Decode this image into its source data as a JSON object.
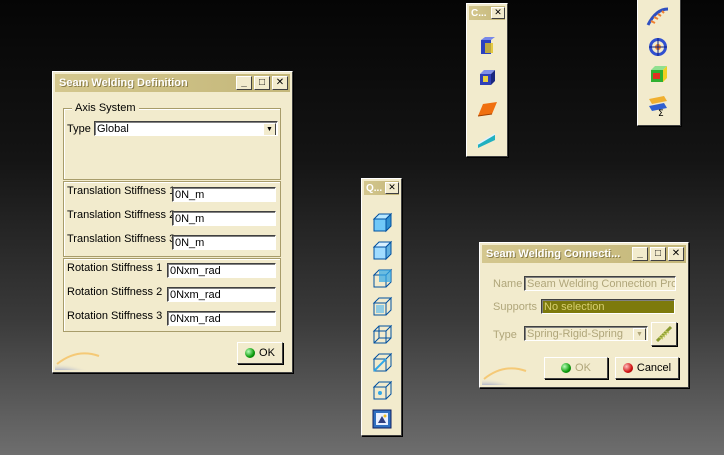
{
  "seam_def": {
    "title": "Seam Welding Definition",
    "axis_group_label": "Axis System",
    "type_label": "Type",
    "type_value": "Global",
    "stiffness_rows": [
      {
        "label": "Translation Stiffness 1",
        "value": "0N_m"
      },
      {
        "label": "Translation Stiffness 2",
        "value": "0N_m"
      },
      {
        "label": "Translation Stiffness 3",
        "value": "0N_m"
      }
    ],
    "rotation_rows": [
      {
        "label": "Rotation Stiffness 1",
        "value": "0Nxm_rad"
      },
      {
        "label": "Rotation Stiffness 2",
        "value": "0Nxm_rad"
      },
      {
        "label": "Rotation Stiffness 3",
        "value": "0Nxm_rad"
      }
    ],
    "ok_label": "OK"
  },
  "seam_conn": {
    "title": "Seam Welding Connecti...",
    "name_label": "Name",
    "name_value": "Seam Welding Connection Pro",
    "supports_label": "Supports",
    "supports_value": "No selection",
    "type_label": "Type",
    "type_value": "Spring-Rigid-Spring",
    "ok_label": "OK",
    "cancel_label": "Cancel"
  },
  "toolbar_c": {
    "title": "C..."
  },
  "toolbar_q": {
    "title": "Q..."
  },
  "title_buttons": {
    "minimize": "_",
    "maximize": "□",
    "close": "✕"
  },
  "colors": {
    "dialog_bg": "#f2ebcd",
    "title_bar": "#c9bc82",
    "supports_field": "#7d7a0c"
  }
}
